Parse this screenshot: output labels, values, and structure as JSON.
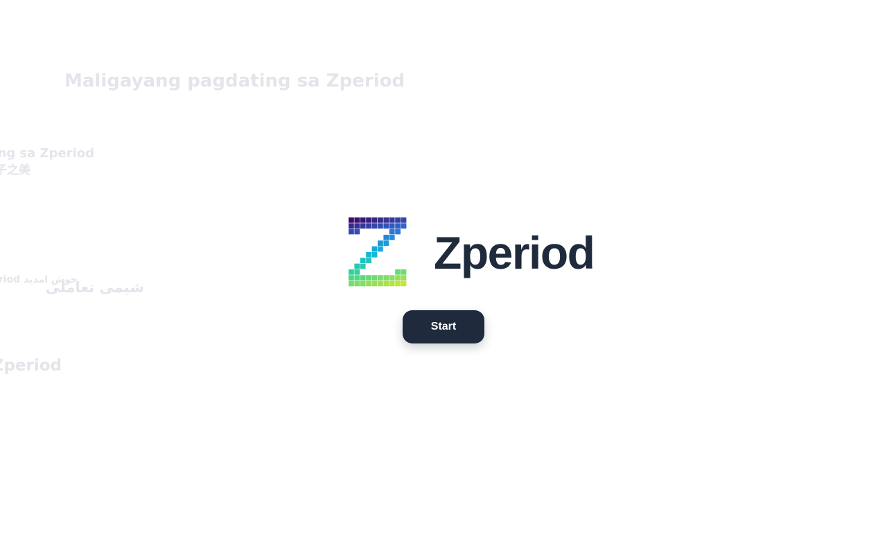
{
  "background_texts": [
    "Maligayang pagdating sa Zperiod",
    "ating sa Zperiod",
    "子之美",
    "خوش امدید eriod",
    "شیمی تعاملی",
    "Zperiod"
  ],
  "brand": {
    "name": "Zperiod",
    "logo_icon": "pixel-z-logo-icon",
    "logo_gradient": [
      "#3b0a6b",
      "#2f6fd6",
      "#12b5dc",
      "#3dd68c",
      "#c8e43a"
    ]
  },
  "actions": {
    "start_label": "Start"
  },
  "colors": {
    "brand_dark": "#1f2a3c",
    "background": "#ffffff",
    "faded_text": "#e3e5ea"
  }
}
